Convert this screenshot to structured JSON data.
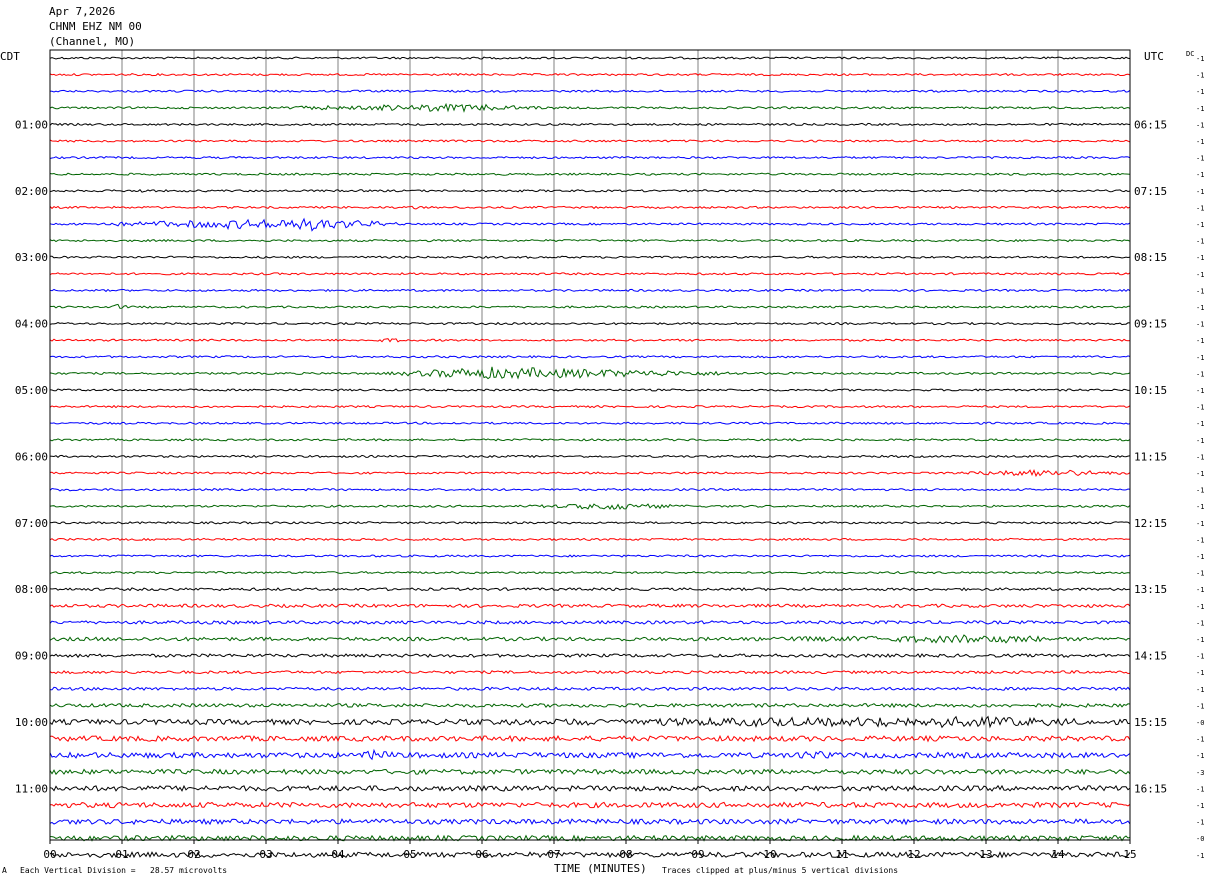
{
  "header": {
    "date": "Apr 7,2026",
    "station": "CHNM EHZ NM 00",
    "channel": "(Channel, MO)"
  },
  "left_zone": "CDT",
  "right_zone": "UTC",
  "dc_label": "DC",
  "footer": {
    "mark": "A",
    "scale": "Each Vertical Division =   28.57 microvolts",
    "xlabel": "TIME (MINUTES)",
    "clip_note": "Traces clipped at plus/minus 5 vertical divisions"
  },
  "chart_data": {
    "type": "line",
    "title": "",
    "xlabel": "TIME (MINUTES)",
    "xlim": [
      0,
      15
    ],
    "x_ticks": [
      "00",
      "01",
      "02",
      "03",
      "04",
      "05",
      "06",
      "07",
      "08",
      "09",
      "10",
      "11",
      "12",
      "13",
      "14",
      "15"
    ],
    "traces_per_hour": 4,
    "colors": [
      "#000000",
      "#ff0000",
      "#0000ff",
      "#006400"
    ],
    "left_hour_labels": [
      "01:00",
      "02:00",
      "03:00",
      "04:00",
      "05:00",
      "06:00",
      "07:00",
      "08:00",
      "09:00",
      "10:00",
      "11:00"
    ],
    "right_hour_labels": [
      "06:15",
      "07:15",
      "08:15",
      "09:15",
      "10:15",
      "11:15",
      "12:15",
      "13:15",
      "14:15",
      "15:15",
      "16:15"
    ],
    "dc_offsets": [
      "-1",
      "-1",
      "-1",
      "-1",
      "-1",
      "-1",
      "-1",
      "-1",
      "-1",
      "-1",
      "-1",
      "-1",
      "-1",
      "-1",
      "-1",
      "-1",
      "-1",
      "-1",
      "-1",
      "-1",
      "-1",
      "-1",
      "-1",
      "-1",
      "-1",
      "-1",
      "-1",
      "-1",
      "-1",
      "-1",
      "-1",
      "-1",
      "-1",
      "-1",
      "-1",
      "-1",
      "-1",
      "-1",
      "-1",
      "-1",
      "-0",
      "-1",
      "-1",
      "-3",
      "-1",
      "-1",
      "-1",
      "-0",
      "-1"
    ],
    "noise_levels": [
      1,
      1,
      1,
      1,
      1,
      1,
      1,
      1,
      1,
      1,
      1,
      1,
      1,
      1,
      1,
      1,
      1,
      1,
      1,
      1,
      1,
      1,
      1,
      1,
      1,
      1,
      1,
      1,
      1,
      1,
      1,
      1,
      1.3,
      1.6,
      1.6,
      1.8,
      1.6,
      1.4,
      1.5,
      1.8,
      2.6,
      2.6,
      2.7,
      2.4,
      2.6,
      2.6,
      2.5,
      2.6,
      2.6
    ],
    "events": [
      {
        "trace": 3,
        "start": 2.7,
        "end": 7.2,
        "peak": 5.6,
        "amp": 3
      },
      {
        "trace": 8,
        "start": 1.2,
        "end": 1.4,
        "peak": 1.3,
        "amp": 1.5
      },
      {
        "trace": 9,
        "start": 5.0,
        "end": 5.15,
        "peak": 5.05,
        "amp": 2
      },
      {
        "trace": 10,
        "start": 0.3,
        "end": 5.0,
        "peak": 3.6,
        "amp": 6
      },
      {
        "trace": 15,
        "start": 0.85,
        "end": 1.1,
        "peak": 0.95,
        "amp": 2
      },
      {
        "trace": 17,
        "start": 4.5,
        "end": 5.0,
        "peak": 4.7,
        "amp": 1.5
      },
      {
        "trace": 19,
        "start": 4.6,
        "end": 10.0,
        "peak": 6.0,
        "amp": 6
      },
      {
        "trace": 25,
        "start": 12.5,
        "end": 15.0,
        "peak": 13.8,
        "amp": 3.5
      },
      {
        "trace": 26,
        "start": 0.0,
        "end": 0.35,
        "peak": 0.05,
        "amp": 2.5
      },
      {
        "trace": 27,
        "start": 6.6,
        "end": 8.9,
        "peak": 7.9,
        "amp": 3
      },
      {
        "trace": 35,
        "start": 9.8,
        "end": 14.0,
        "peak": 13.2,
        "amp": 3
      },
      {
        "trace": 40,
        "start": 5.6,
        "end": 14.5,
        "peak": 13.0,
        "amp": 3.5
      },
      {
        "trace": 42,
        "start": 4.3,
        "end": 4.8,
        "peak": 4.5,
        "amp": 2.5
      },
      {
        "trace": 42,
        "start": 10.3,
        "end": 10.9,
        "peak": 10.6,
        "amp": 2
      }
    ]
  }
}
